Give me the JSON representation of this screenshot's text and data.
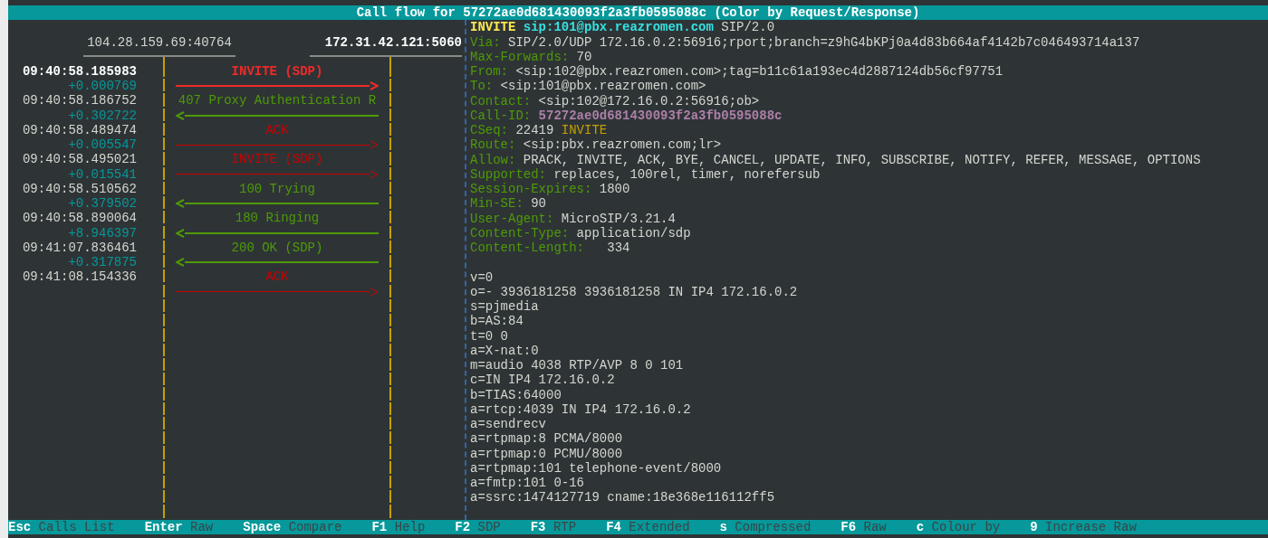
{
  "title": "Call flow for 57272ae0d681430093f2a3fb0595088c (Color by Request/Response)",
  "hosts": [
    {
      "address": "104.28.159.69:40764",
      "selected": false
    },
    {
      "address": "172.31.42.121:5060",
      "selected": true
    }
  ],
  "messages": [
    {
      "time": "09:40:58.185983",
      "delta": "+0.000769",
      "label": "INVITE (SDP)",
      "color": "#ef2929",
      "kind": "rightward",
      "selected": true
    },
    {
      "time": "09:40:58.186752",
      "delta": "+0.302722",
      "label": "407 Proxy Authentication R",
      "color": "#4e9a06",
      "kind": "leftward",
      "selected": false
    },
    {
      "time": "09:40:58.489474",
      "delta": "+0.005547",
      "label": "ACK",
      "color": "#cc0000",
      "kind": "rightward",
      "selected": false
    },
    {
      "time": "09:40:58.495021",
      "delta": "+0.015541",
      "label": "INVITE (SDP)",
      "color": "#cc0000",
      "kind": "rightward",
      "selected": false
    },
    {
      "time": "09:40:58.510562",
      "delta": "+0.379502",
      "label": "100 Trying",
      "color": "#4e9a06",
      "kind": "leftward",
      "selected": false
    },
    {
      "time": "09:40:58.890064",
      "delta": "+8.946397",
      "label": "180 Ringing",
      "color": "#4e9a06",
      "kind": "leftward",
      "selected": false
    },
    {
      "time": "09:41:07.836461",
      "delta": "+0.317875",
      "label": "200 OK (SDP)",
      "color": "#4e9a06",
      "kind": "leftward",
      "selected": false
    },
    {
      "time": "09:41:08.154336",
      "label": "ACK",
      "color": "#cc0000",
      "kind": "rightward",
      "selected": false
    }
  ],
  "sip_message": {
    "request_line": {
      "method": "INVITE",
      "uri": "sip:101@pbx.reazromen.com",
      "version": "SIP/2.0"
    },
    "headers": [
      {
        "kind": "plain",
        "name": "Via:",
        "value": "SIP/2.0/UDP 172.16.0.2:56916;rport;branch=z9hG4bKPj0a4d83b664af4142b7c046493714a137"
      },
      {
        "kind": "plain",
        "name": "Max-Forwards:",
        "value": "70"
      },
      {
        "kind": "plain",
        "name": "From:",
        "value": "<sip:102@pbx.reazromen.com>;tag=b11c61a193ec4d2887124db56cf97751"
      },
      {
        "kind": "plain",
        "name": "To:",
        "value": "<sip:101@pbx.reazromen.com>"
      },
      {
        "kind": "plain",
        "name": "Contact:",
        "value": "<sip:102@172.16.0.2:56916;ob>"
      },
      {
        "kind": "call-id",
        "name": "Call-ID:",
        "value": "57272ae0d681430093f2a3fb0595088c"
      },
      {
        "kind": "cseq",
        "name": "CSeq:",
        "value": "22419",
        "method": "INVITE"
      },
      {
        "kind": "plain",
        "name": "Route:",
        "value": "<sip:pbx.reazromen.com;lr>"
      },
      {
        "kind": "plain",
        "name": "Allow:",
        "value": "PRACK, INVITE, ACK, BYE, CANCEL, UPDATE, INFO, SUBSCRIBE, NOTIFY, REFER, MESSAGE, OPTIONS"
      },
      {
        "kind": "plain",
        "name": "Supported:",
        "value": "replaces, 100rel, timer, norefersub"
      },
      {
        "kind": "plain",
        "name": "Session-Expires:",
        "value": "1800"
      },
      {
        "kind": "plain",
        "name": "Min-SE:",
        "value": "90"
      },
      {
        "kind": "plain",
        "name": "User-Agent:",
        "value": "MicroSIP/3.21.4"
      },
      {
        "kind": "plain",
        "name": "Content-Type:",
        "value": "application/sdp"
      },
      {
        "kind": "plain",
        "name": "Content-Length:",
        "value": "  334"
      }
    ],
    "sdp": [
      "v=0",
      "o=- 3936181258 3936181258 IN IP4 172.16.0.2",
      "s=pjmedia",
      "b=AS:84",
      "t=0 0",
      "a=X-nat:0",
      "m=audio 4038 RTP/AVP 8 0 101",
      "c=IN IP4 172.16.0.2",
      "b=TIAS:64000",
      "a=rtcp:4039 IN IP4 172.16.0.2",
      "a=sendrecv",
      "a=rtpmap:8 PCMA/8000",
      "a=rtpmap:0 PCMU/8000",
      "a=rtpmap:101 telephone-event/8000",
      "a=fmtp:101 0-16",
      "a=ssrc:1474127719 cname:18e368e116112ff5"
    ]
  },
  "footer": [
    {
      "key": "Esc",
      "label": "Calls List"
    },
    {
      "key": "Enter",
      "label": "Raw"
    },
    {
      "key": "Space",
      "label": "Compare"
    },
    {
      "key": "F1",
      "label": "Help"
    },
    {
      "key": "F2",
      "label": "SDP"
    },
    {
      "key": "F3",
      "label": "RTP"
    },
    {
      "key": "F4",
      "label": "Extended"
    },
    {
      "key": "s",
      "label": "Compressed"
    },
    {
      "key": "F6",
      "label": "Raw"
    },
    {
      "key": "c",
      "label": "Colour by"
    },
    {
      "key": "9",
      "label": "Increase Raw"
    }
  ]
}
